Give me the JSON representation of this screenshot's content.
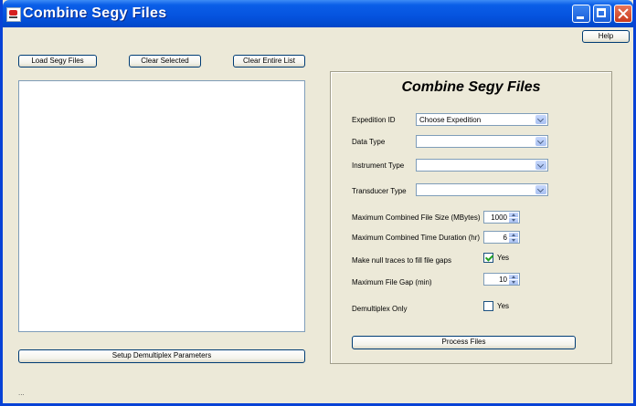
{
  "window": {
    "title": "Combine Segy Files"
  },
  "toolbar": {
    "help_label": "Help",
    "load_label": "Load Segy Files",
    "clear_selected_label": "Clear Selected",
    "clear_all_label": "Clear Entire List",
    "demux_params_label": "Setup Demultiplex Parameters"
  },
  "panel": {
    "heading": "Combine Segy Files",
    "expedition": {
      "label": "Expedition ID",
      "value": "Choose Expedition"
    },
    "data_type": {
      "label": "Data Type",
      "value": ""
    },
    "instrument_type": {
      "label": "Instrument Type",
      "value": ""
    },
    "transducer_type": {
      "label": "Transducer Type",
      "value": ""
    },
    "max_file_size": {
      "label": "Maximum Combined File Size (MBytes)",
      "value": "1000"
    },
    "max_duration": {
      "label": "Maximum Combined Time Duration (hr)",
      "value": "6"
    },
    "null_traces": {
      "label": "Make null traces to fill file gaps",
      "checked": true,
      "check_label": "Yes"
    },
    "max_gap": {
      "label": "Maximum File Gap (min)",
      "value": "10"
    },
    "demux_only": {
      "label": "Demultiplex Only",
      "checked": false,
      "check_label": "Yes"
    },
    "process_label": "Process Files"
  },
  "status_text": "..."
}
